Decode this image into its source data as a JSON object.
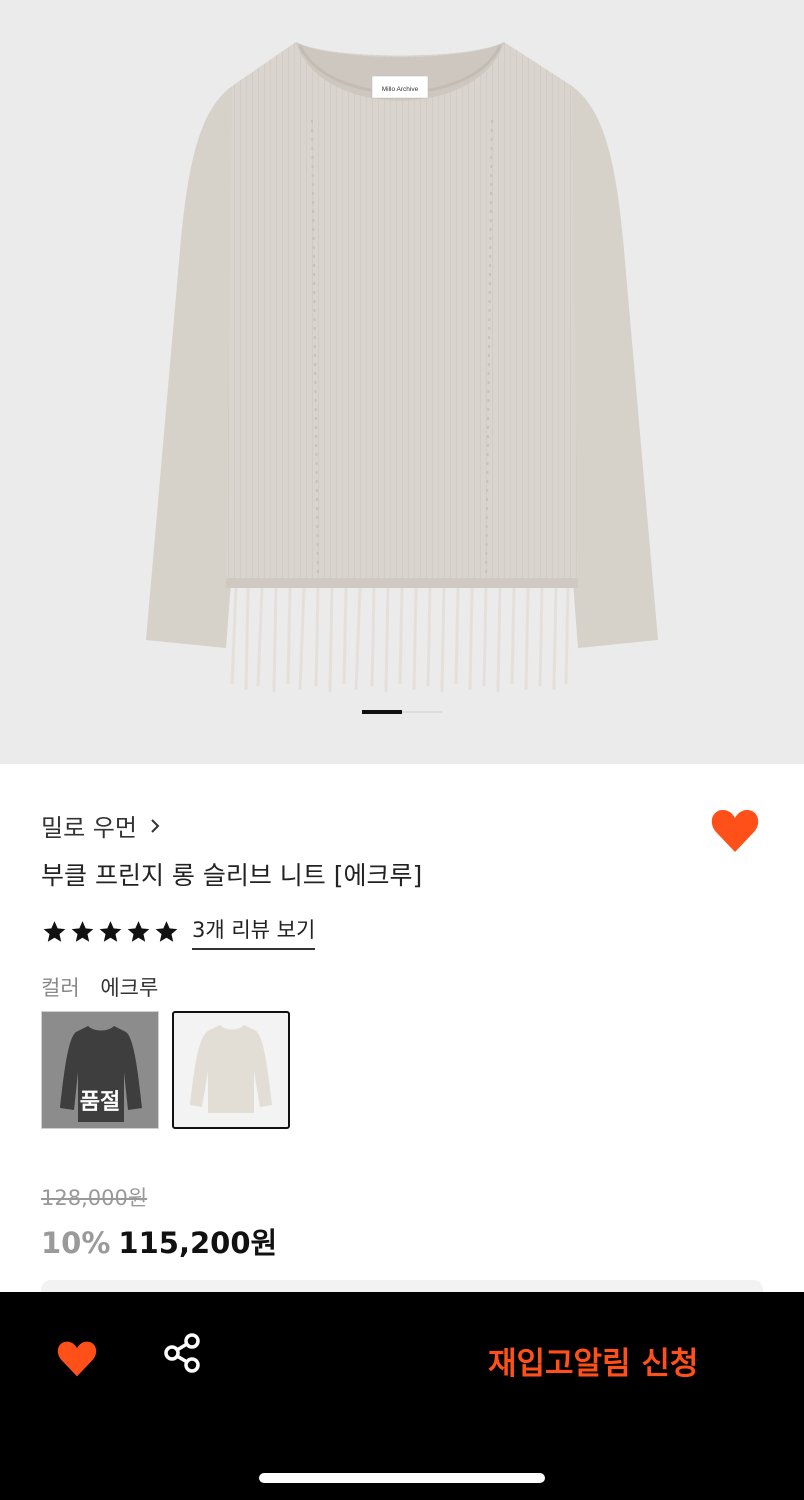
{
  "product": {
    "brand": "밀로 우먼",
    "title": "부클 프린지 롱 슬리브 니트 [에크루]",
    "image_label": "Millo Archive",
    "rating_stars": 5,
    "review_link": "3개 리뷰 보기",
    "color_label": "컬러",
    "color_value": "에크루",
    "swatches": [
      {
        "color": "#3e3e3e",
        "status": "품절"
      },
      {
        "color": "#e2ddd5",
        "status": ""
      }
    ],
    "original_price": "128,000원",
    "discount": "10%",
    "price": "115,200원"
  },
  "carousel": {
    "current_page": 1,
    "total_pages": 2
  },
  "bottom_bar": {
    "wishlist_icon": "heart-icon",
    "share_icon": "share-icon",
    "cta_label": "재입고알림 신청"
  },
  "colors": {
    "accent": "#ff5019",
    "bar_bg": "#000000",
    "hero_bg": "#ebebeb",
    "sweater": "#d9d4cd"
  }
}
